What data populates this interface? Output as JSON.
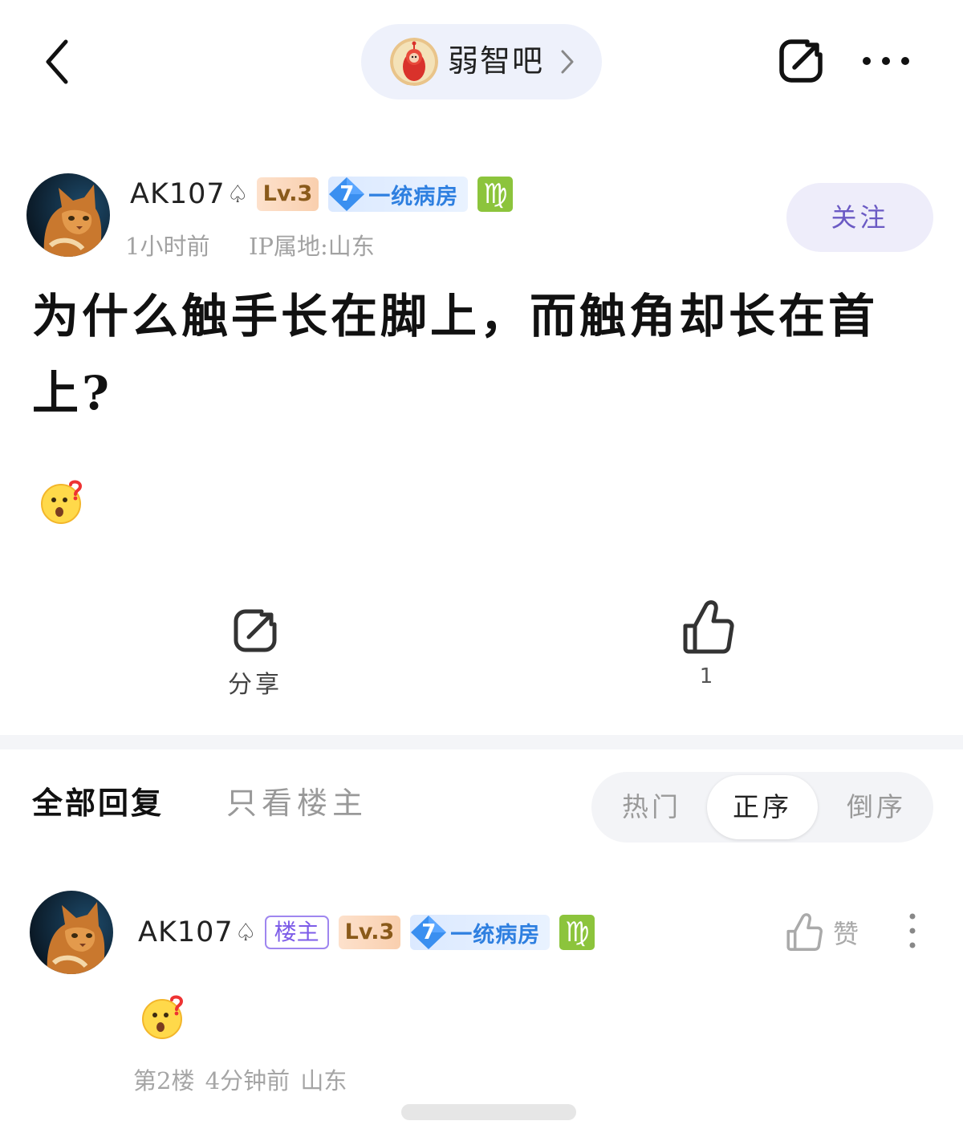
{
  "topbar": {
    "forum_name": "弱智吧",
    "back_icon": "chevron-left-icon",
    "share_icon": "share-icon",
    "more_icon": "more-dots-icon"
  },
  "post": {
    "author": {
      "username": "AK107",
      "spade": "♤",
      "level": "Lv.3",
      "badge_number": "7",
      "badge_text": "一统病房",
      "zodiac": "♍"
    },
    "time": "1小时前",
    "ip": "IP属地:山东",
    "follow_label": "关注",
    "title": "为什么触手长在脚上，而触角却长在首上?",
    "actions": {
      "share_label": "分享",
      "like_count": "1"
    }
  },
  "replies_header": {
    "tab_all": "全部回复",
    "tab_host_only": "只看楼主",
    "sort_hot": "热门",
    "sort_asc": "正序",
    "sort_desc": "倒序"
  },
  "reply": {
    "author": {
      "username": "AK107",
      "spade": "♤",
      "host_tag": "楼主",
      "level": "Lv.3",
      "badge_number": "7",
      "badge_text": "一统病房",
      "zodiac": "♍"
    },
    "like_label": "赞",
    "meta": "第2楼  4分钟前  山东"
  },
  "colors": {
    "accent": "#6b5ac4",
    "badge_blue": "#2e7fe0",
    "zodiac_green": "#8cc43c",
    "muted_text": "#a2a2a2"
  }
}
